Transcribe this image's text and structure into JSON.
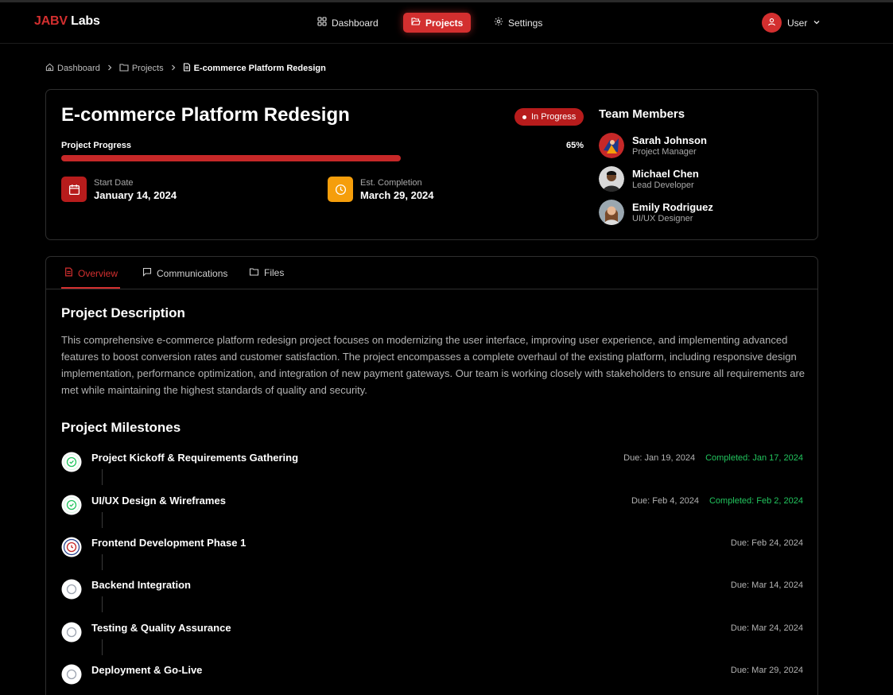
{
  "nav": {
    "brand_red": "JABV",
    "brand_rest": " Labs",
    "items": [
      {
        "label": "Dashboard",
        "icon": "grid-icon"
      },
      {
        "label": "Projects",
        "icon": "folder-icon"
      },
      {
        "label": "Settings",
        "icon": "gear-icon"
      }
    ],
    "user_label": "User"
  },
  "breadcrumb": [
    "Dashboard",
    "Projects",
    "E-commerce Platform Redesign"
  ],
  "project": {
    "title": "E-commerce Platform Redesign",
    "status": "In Progress",
    "progress_label": "Project Progress",
    "progress_value": 65,
    "progress_text": "65%",
    "start_label": "Start Date",
    "start_value": "January 14, 2024",
    "completion_label": "Est. Completion",
    "completion_value": "March 29, 2024"
  },
  "team": {
    "title": "Team Members",
    "members": [
      {
        "name": "Sarah Johnson",
        "role": "Project Manager"
      },
      {
        "name": "Michael Chen",
        "role": "Lead Developer"
      },
      {
        "name": "Emily Rodriguez",
        "role": "UI/UX Designer"
      }
    ]
  },
  "tabs": [
    "Overview",
    "Communications",
    "Files"
  ],
  "overview": {
    "description_title": "Project Description",
    "description": "This comprehensive e-commerce platform redesign project focuses on modernizing the user interface, improving user experience, and implementing advanced features to boost conversion rates and customer satisfaction. The project encompasses a complete overhaul of the existing platform, including responsive design implementation, performance optimization, and integration of new payment gateways. Our team is working closely with stakeholders to ensure all requirements are met while maintaining the highest standards of quality and security.",
    "milestones_title": "Project Milestones",
    "milestones": [
      {
        "title": "Project Kickoff & Requirements Gathering",
        "due": "Due: Jan 19, 2024",
        "completed": "Completed: Jan 17, 2024",
        "state": "done"
      },
      {
        "title": "UI/UX Design & Wireframes",
        "due": "Due: Feb 4, 2024",
        "completed": "Completed: Feb 2, 2024",
        "state": "done"
      },
      {
        "title": "Frontend Development Phase 1",
        "due": "Due: Feb 24, 2024",
        "completed": "",
        "state": "active"
      },
      {
        "title": "Backend Integration",
        "due": "Due: Mar 14, 2024",
        "completed": "",
        "state": "pending"
      },
      {
        "title": "Testing & Quality Assurance",
        "due": "Due: Mar 24, 2024",
        "completed": "",
        "state": "pending"
      },
      {
        "title": "Deployment & Go-Live",
        "due": "Due: Mar 29, 2024",
        "completed": "",
        "state": "pending"
      }
    ]
  },
  "colors": {
    "accent": "#d32f2f",
    "success": "#22c55e",
    "warning": "#f59e0b",
    "background": "#000000"
  }
}
